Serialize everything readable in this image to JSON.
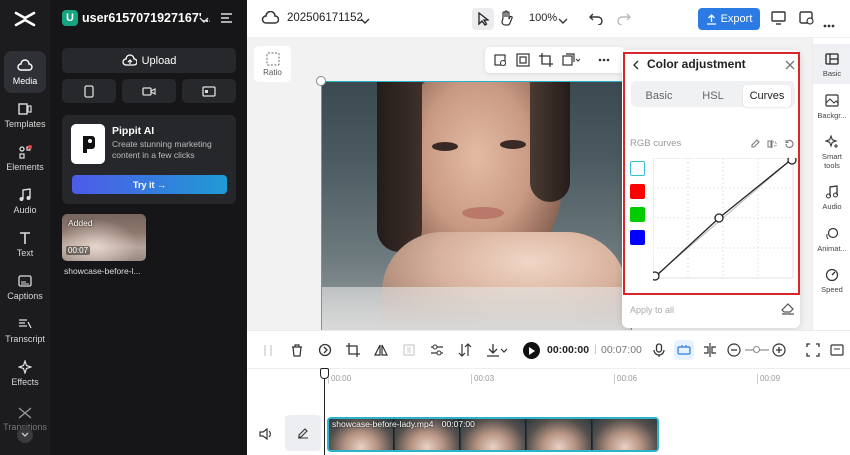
{
  "app": {
    "logo": "capcut-logo"
  },
  "account": {
    "avatar_letter": "U",
    "username": "user6157071927167'...",
    "avatar_color": "#16a37f"
  },
  "leftnav": {
    "items": [
      {
        "label": "Media"
      },
      {
        "label": "Templates"
      },
      {
        "label": "Elements"
      },
      {
        "label": "Audio"
      },
      {
        "label": "Text"
      },
      {
        "label": "Captions"
      },
      {
        "label": "Transcript"
      },
      {
        "label": "Effects"
      },
      {
        "label": "Transitions"
      }
    ]
  },
  "leftpanel": {
    "upload_label": "Upload",
    "promo": {
      "title": "Pippit AI",
      "desc": "Create stunning marketing content in a few clicks",
      "cta": "Try it →"
    },
    "media": {
      "badge": "Added",
      "duration": "00:07",
      "name": "showcase-before-l..."
    }
  },
  "topbar": {
    "project_name": "202506171152",
    "zoom": "100%",
    "export_label": "Export",
    "accent": "#2c7be5"
  },
  "canvas": {
    "ratio_label": "Ratio"
  },
  "colorpanel": {
    "title": "Color adjustment",
    "tabs": [
      "Basic",
      "HSL",
      "Curves"
    ],
    "active_tab": "Curves",
    "section_label": "RGB curves",
    "channels": [
      {
        "name": "white",
        "color": "#ffffff"
      },
      {
        "name": "red",
        "color": "#ff0000"
      },
      {
        "name": "green",
        "color": "#00cc00"
      },
      {
        "name": "blue",
        "color": "#0000ff"
      }
    ],
    "apply_all": "Apply to all"
  },
  "righttools": {
    "items": [
      {
        "label": "Basic"
      },
      {
        "label": "Backgr..."
      },
      {
        "label": "Smart tools"
      },
      {
        "label": "Audio"
      },
      {
        "label": "Animat..."
      },
      {
        "label": "Speed"
      }
    ]
  },
  "playback": {
    "current_time": "00:00:00",
    "separator": "|",
    "total_time": "00:07:00"
  },
  "timeline": {
    "ticks": [
      "00:00",
      "00:03",
      "00:06",
      "00:09"
    ],
    "clip_name": "showcase-before-lady.mp4",
    "clip_duration": "00:07:00"
  }
}
